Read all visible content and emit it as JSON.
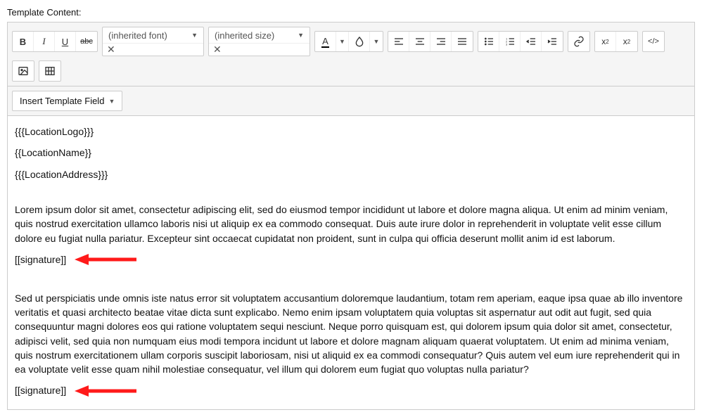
{
  "label": "Template Content:",
  "toolbar": {
    "bold": "B",
    "italic": "I",
    "underline": "U",
    "strike": "abc",
    "font_select": "(inherited font)",
    "size_select": "(inherited size)",
    "font_color": "A",
    "insert_btn": "Insert Template Field"
  },
  "body": {
    "tag1": "{{{LocationLogo}}}",
    "tag2": "{{LocationName}}",
    "tag3": "{{{LocationAddress}}}",
    "para1": "Lorem ipsum dolor sit amet, consectetur adipiscing elit, sed do eiusmod tempor incididunt ut labore et dolore magna aliqua. Ut enim ad minim veniam, quis nostrud exercitation ullamco laboris nisi ut aliquip ex ea commodo consequat. Duis aute irure dolor in reprehenderit in voluptate velit esse cillum dolore eu fugiat nulla pariatur. Excepteur sint occaecat cupidatat non proident, sunt in culpa qui officia deserunt mollit anim id est laborum.",
    "sig1": "[[signature]]",
    "para2": "Sed ut perspiciatis unde omnis iste natus error sit voluptatem accusantium doloremque laudantium, totam rem aperiam, eaque ipsa quae ab illo inventore veritatis et quasi architecto beatae vitae dicta sunt explicabo. Nemo enim ipsam voluptatem quia voluptas sit aspernatur aut odit aut fugit, sed quia consequuntur magni dolores eos qui ratione voluptatem sequi nesciunt. Neque porro quisquam est, qui dolorem ipsum quia dolor sit amet, consectetur, adipisci velit, sed quia non numquam eius modi tempora incidunt ut labore et dolore magnam aliquam quaerat voluptatem. Ut enim ad minima veniam, quis nostrum exercitationem ullam corporis suscipit laboriosam, nisi ut aliquid ex ea commodi consequatur? Quis autem vel eum iure reprehenderit qui in ea voluptate velit esse quam nihil molestiae consequatur, vel illum qui dolorem eum fugiat quo voluptas nulla pariatur?",
    "sig2": "[[signature]]"
  }
}
